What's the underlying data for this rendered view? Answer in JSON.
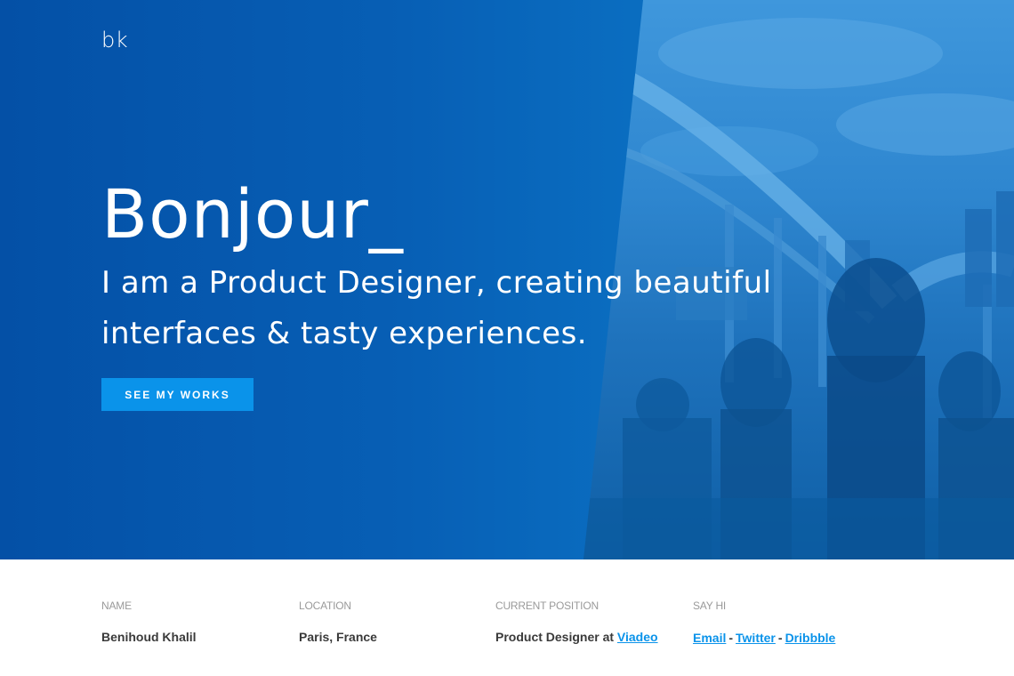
{
  "header": {
    "logo": "bk"
  },
  "hero": {
    "headline": "Bonjour_",
    "tagline_line1": "I am a Product Designer, creating beautiful",
    "tagline_line2": "interfaces & tasty experiences.",
    "cta_label": "SEE MY WORKS"
  },
  "info": {
    "name": {
      "label": "NAME",
      "value": "Benihoud Khalil"
    },
    "location": {
      "label": "LOCATION",
      "value": "Paris, France"
    },
    "position": {
      "label": "CURRENT POSITION",
      "value_prefix": "Product Designer at",
      "company": "Viadeo"
    },
    "say_hi": {
      "label": "SAY HI",
      "links": [
        "Email",
        "Twitter",
        "Dribbble"
      ],
      "separator": "-"
    }
  },
  "colors": {
    "hero_blue": "#0557ad",
    "accent": "#0a93ea",
    "label_gray": "#9a9a9a",
    "text_dark": "#3a3a3a"
  }
}
